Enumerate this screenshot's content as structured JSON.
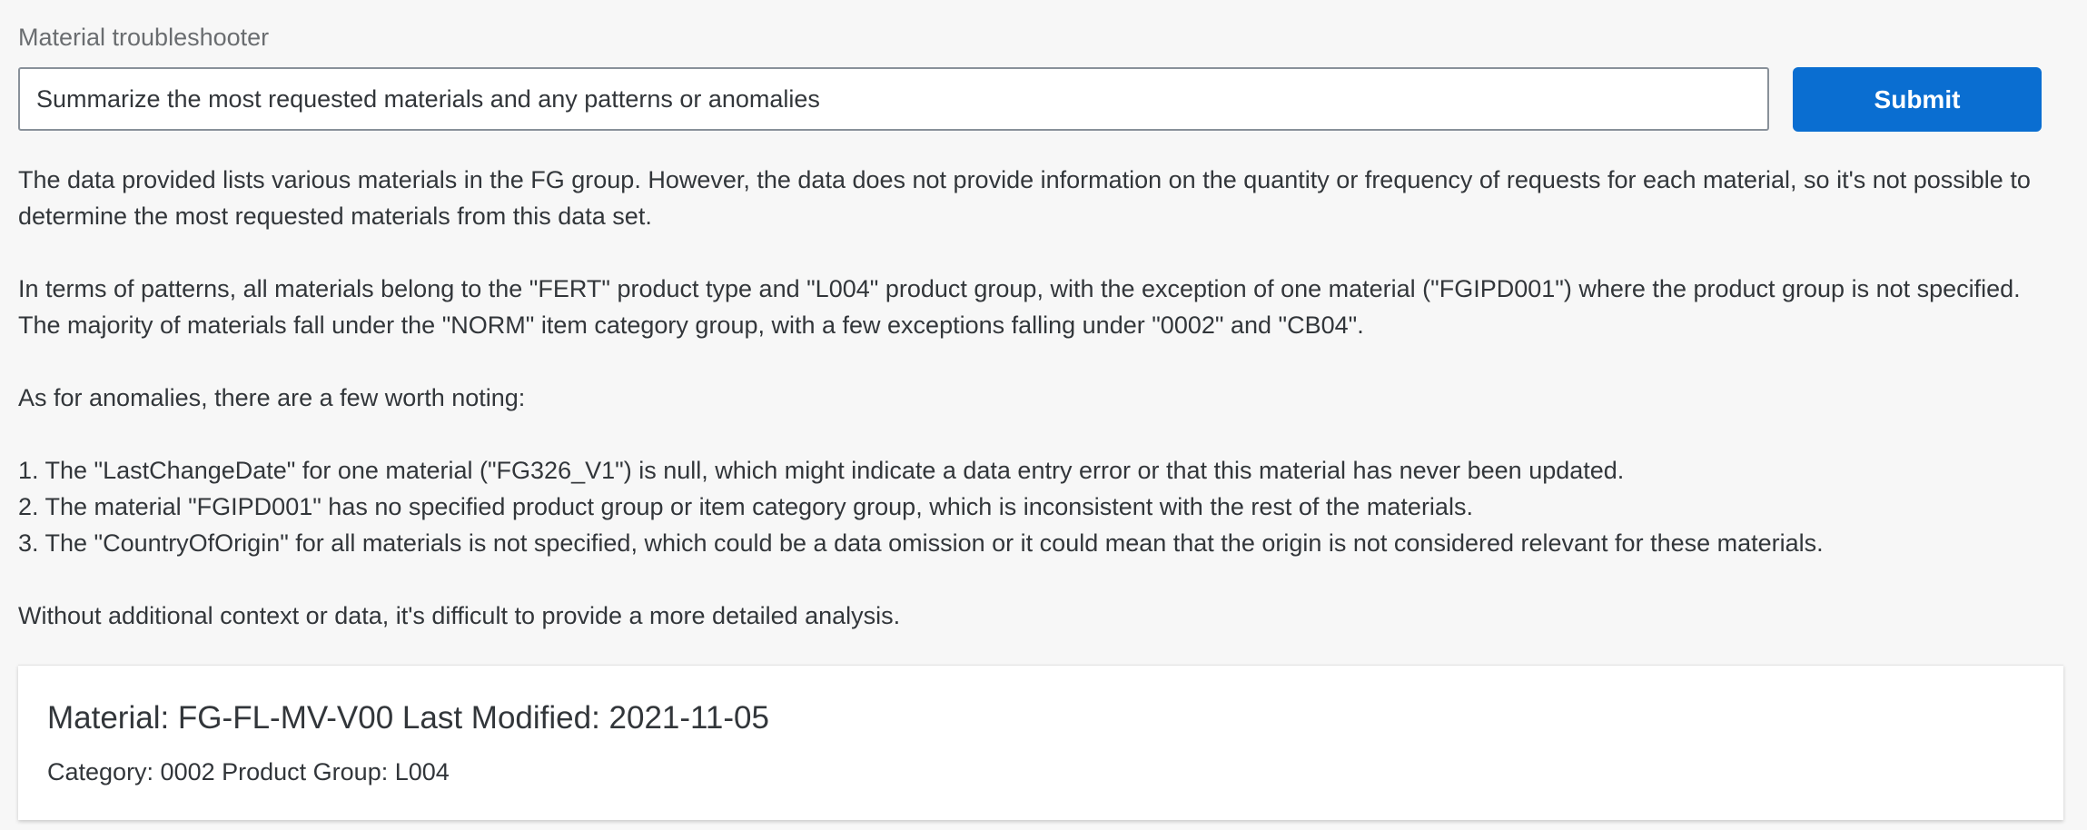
{
  "troubleshooter": {
    "label": "Material troubleshooter",
    "query_value": "Summarize the most requested materials and any patterns or anomalies",
    "submit_label": "Submit"
  },
  "answer": {
    "paragraph_1": "The data provided lists various materials in the FG group. However, the data does not provide information on the quantity or frequency of requests for each material, so it's not possible to determine the most requested materials from this data set.",
    "paragraph_2": "In terms of patterns, all materials belong to the \"FERT\" product type and \"L004\" product group, with the exception of one material (\"FGIPD001\") where the product group is not specified. The majority of materials fall under the \"NORM\" item category group, with a few exceptions falling under \"0002\" and \"CB04\".",
    "paragraph_3": "As for anomalies, there are a few worth noting:",
    "anomalies": [
      "1. The \"LastChangeDate\" for one material (\"FG326_V1\") is null, which might indicate a data entry error or that this material has never been updated.",
      "2. The material \"FGIPD001\" has no specified product group or item category group, which is inconsistent with the rest of the materials.",
      "3. The \"CountryOfOrigin\" for all materials is not specified, which could be a data omission or it could mean that the origin is not considered relevant for these materials."
    ],
    "paragraph_4": "Without additional context or data, it's difficult to provide a more detailed analysis."
  },
  "material_card": {
    "title": "Material: FG-FL-MV-V00 Last Modified: 2021-11-05",
    "subtitle": "Category: 0002 Product Group: L004"
  },
  "colors": {
    "accent": "#0a6ed1",
    "background": "#f7f7f7",
    "text": "#32363a",
    "label": "#6a6d70"
  }
}
